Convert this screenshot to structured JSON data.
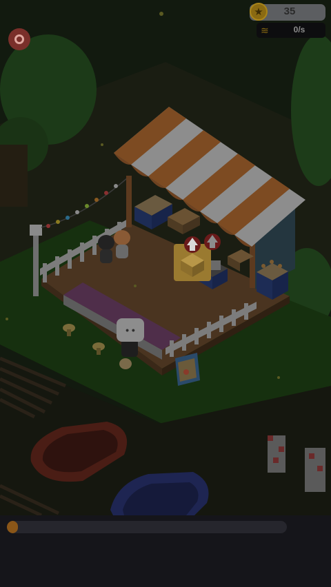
{
  "hud": {
    "coins": "35",
    "coin_icon": "star-coin-icon",
    "income_rate": "0/s",
    "income_icon": "cash-stack-icon",
    "settings_icon": "gear-icon"
  },
  "player": {
    "label": "• •"
  },
  "progress": {
    "fraction": 0.03
  },
  "colors": {
    "background": "#121a0f",
    "awning_orange": "#7d4b22",
    "awning_white": "#8d8d8d",
    "coin_gold": "#8a6a12",
    "progress_fill": "#8a5618"
  }
}
